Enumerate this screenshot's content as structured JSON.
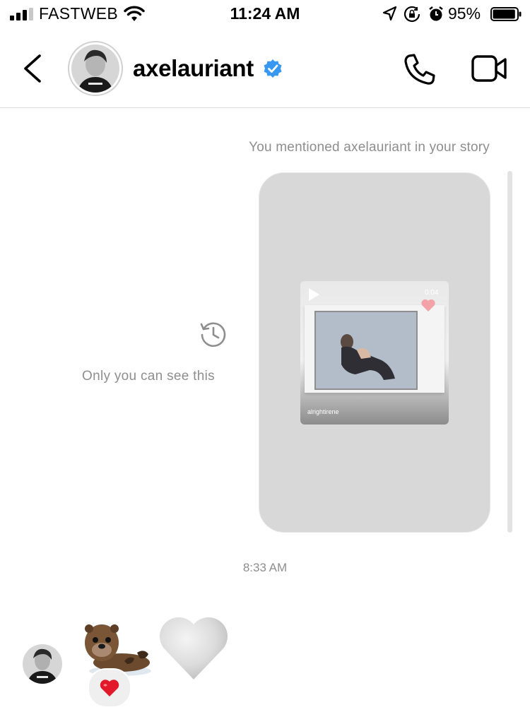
{
  "status_bar": {
    "carrier": "FASTWEB",
    "time": "11:24 AM",
    "battery_percent": "95%",
    "battery_level": 0.95,
    "icons": [
      "signal-icon",
      "wifi-icon",
      "location-icon",
      "rotation-lock-icon",
      "alarm-icon",
      "battery-icon"
    ]
  },
  "header": {
    "username": "axelauriant",
    "verified": true,
    "icons": [
      "back-chevron-icon",
      "verified-badge-icon",
      "phone-icon",
      "video-camera-icon"
    ],
    "accent_color": "#3897f0"
  },
  "thread": {
    "mention_note": "You mentioned axelauriant in your story",
    "story": {
      "duration": "0:04",
      "author": "alrightirene"
    },
    "private_note": "Only you can see this",
    "message_time": "8:33 AM",
    "sticker_name": "otter-sticker",
    "reaction_emoji": "❤️",
    "last_message_emoji": "🤍"
  }
}
